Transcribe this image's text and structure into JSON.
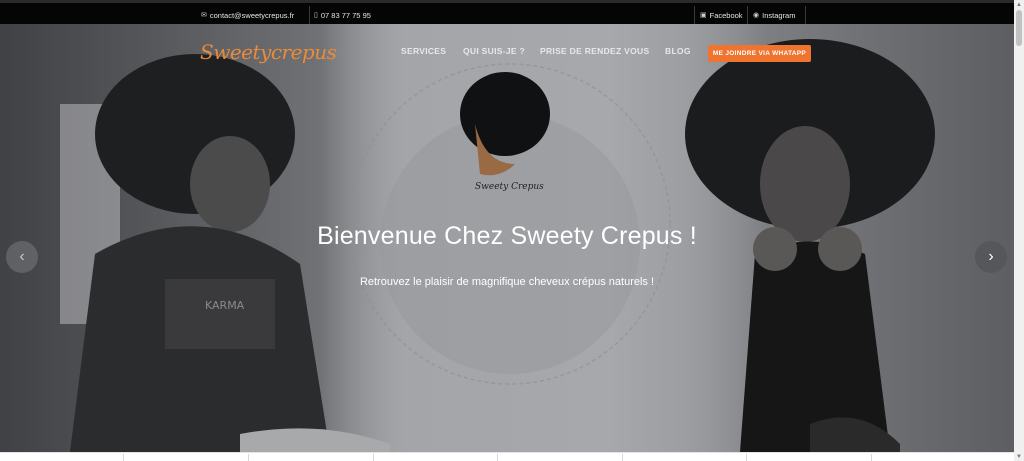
{
  "topbar": {
    "email": "contact@sweetycrepus.fr",
    "phone": "07 83 77 75 95",
    "facebook": "Facebook",
    "instagram": "Instagram"
  },
  "brand": {
    "logo_text": "Sweetycrepus"
  },
  "nav": {
    "items": [
      "SERVICES",
      "QUI SUIS-JE ?",
      "PRISE DE RENDEZ VOUS",
      "BLOG"
    ],
    "cta": "ME JOINDRE VIA WHATAPP"
  },
  "hero": {
    "title": "Bienvenue Chez Sweety Crepus !",
    "subtitle": "Retrouvez le plaisir de magnifique cheveux crépus naturels !",
    "emblem_text": "Sweety Crepus"
  },
  "colors": {
    "accent": "#ee7430",
    "topbar_bg": "#050505",
    "logo": "#e98b3b"
  },
  "icons": [
    "envelope-icon",
    "phone-icon",
    "facebook-icon",
    "instagram-icon",
    "chevron-left-icon",
    "chevron-right-icon"
  ]
}
